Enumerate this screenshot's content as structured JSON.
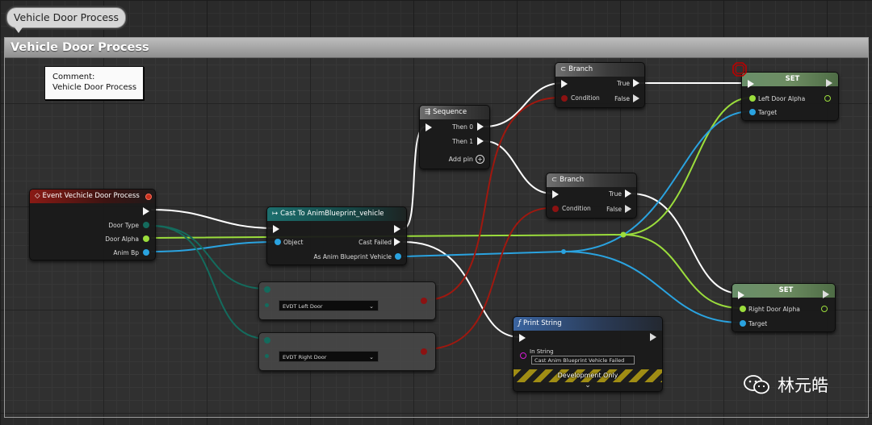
{
  "tab": {
    "label": "Vehicle Door Process"
  },
  "comment_header": {
    "title": "Vehicle Door Process"
  },
  "note": {
    "line1": "Comment:",
    "line2": "Vehicle Door Process"
  },
  "colors": {
    "exec": "#f4f4f4",
    "object": "#2aa3e0",
    "float": "#9bdd3c",
    "byte": "#146b5d",
    "bool": "#8c1212",
    "string": "#d61bd6"
  },
  "nodes": {
    "event": {
      "title": "Event Vechicle Door Process",
      "pins": [
        "Door Type",
        "Door Alpha",
        "Anim Bp"
      ]
    },
    "cast": {
      "title": "Cast To AnimBlueprint_vehicle",
      "object": "Object",
      "failed": "Cast Failed",
      "as_bp": "As Anim Blueprint Vehicle"
    },
    "sequence": {
      "title": "Sequence",
      "then0": "Then 0",
      "then1": "Then 1",
      "add_pin": "Add pin"
    },
    "branch1": {
      "title": "Branch",
      "condition": "Condition",
      "true": "True",
      "false": "False"
    },
    "branch2": {
      "title": "Branch",
      "condition": "Condition",
      "true": "True",
      "false": "False"
    },
    "enum_left": {
      "value": "EVDT Left Door"
    },
    "enum_right": {
      "value": "EVDT Right Door"
    },
    "set_left": {
      "title": "SET",
      "var": "Left Door Alpha",
      "target": "Target"
    },
    "set_right": {
      "title": "SET",
      "var": "Right Door Alpha",
      "target": "Target"
    },
    "print": {
      "title": "Print String",
      "in_string": "In String",
      "default": "Cast Anim Blueprint Vehicle Failed",
      "dev_only": "Development Only"
    }
  },
  "watermark": {
    "text": "林元皓"
  }
}
